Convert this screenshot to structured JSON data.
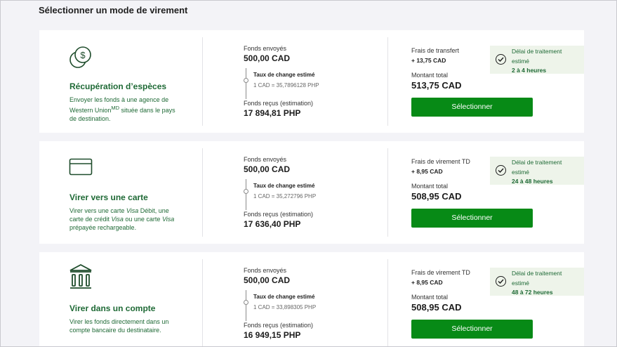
{
  "page": {
    "title": "Sélectionner un mode de virement"
  },
  "options": [
    {
      "icon": "cash-coins-icon",
      "title": "Récupération d’espèces",
      "desc": "Envoyer les fonds à une agence de Western Union<sup>MD</sup> située dans le pays de destination.",
      "sent_label": "Fonds envoyés",
      "sent_amount": "500,00 CAD",
      "rate_label": "Taux de change estimé",
      "rate_value": "1 CAD = 35,7896128 PHP",
      "received_label": "Fonds reçus (estimation)",
      "received_amount": "17 894,81 PHP",
      "fee_label": "Frais de transfert",
      "fee_value": "+ 13,75 CAD",
      "total_label": "Montant total",
      "total_value": "513,75 CAD",
      "delay_label": "Délai de traitement estimé",
      "delay_value": "2 à 4 heures",
      "button_label": "Sélectionner"
    },
    {
      "icon": "credit-card-icon",
      "title": "Virer vers une carte",
      "desc": "Virer vers une carte <i>Visa</i> Débit, une carte de crédit <i>Visa</i> ou une carte <i>Visa</i> prépayée rechargeable.",
      "sent_label": "Fonds envoyés",
      "sent_amount": "500,00 CAD",
      "rate_label": "Taux de change estimé",
      "rate_value": "1 CAD = 35,272796 PHP",
      "received_label": "Fonds reçus (estimation)",
      "received_amount": "17 636,40 PHP",
      "fee_label": "Frais de virement TD",
      "fee_value": "+ 8,95 CAD",
      "total_label": "Montant total",
      "total_value": "508,95 CAD",
      "delay_label": "Délai de traitement estimé",
      "delay_value": "24 à 48 heures",
      "button_label": "Sélectionner"
    },
    {
      "icon": "bank-icon",
      "title": "Virer dans un compte",
      "desc": "Virer les fonds directement dans un compte bancaire du destinataire.",
      "sent_label": "Fonds envoyés",
      "sent_amount": "500,00 CAD",
      "rate_label": "Taux de change estimé",
      "rate_value": "1 CAD = 33,898305 PHP",
      "received_label": "Fonds reçus (estimation)",
      "received_amount": "16 949,15 PHP",
      "fee_label": "Frais de virement TD",
      "fee_value": "+ 8,95 CAD",
      "total_label": "Montant total",
      "total_value": "508,95 CAD",
      "delay_label": "Délai de traitement estimé",
      "delay_value": "48 à 72 heures",
      "button_label": "Sélectionner"
    }
  ],
  "colors": {
    "accent_green": "#078a16",
    "text_green": "#1f6a36",
    "delay_bg": "#eef4ea"
  }
}
